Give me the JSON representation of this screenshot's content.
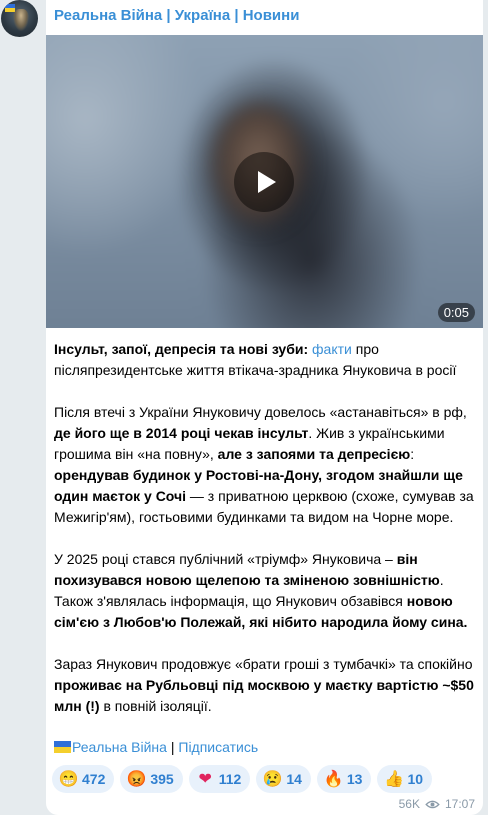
{
  "channel": {
    "name": "Реальна Війна | Україна | Новини"
  },
  "video": {
    "duration": "0:05"
  },
  "post": {
    "p1_b1": "Інсульт, запої, депресія та нові зуби:",
    "p1_link": "факти",
    "p1_t1": " про післяпрезидентське життя втікача-зрадника Януковича в росії",
    "p2_t1": "Після втечі з України Януковичу довелось «астанавіться» в рф, ",
    "p2_b1": "де його ще в 2014 році чекав інсульт",
    "p2_t2": ". Жив з українськими грошима він «на повну», ",
    "p2_b2": "але з запоями та депресією",
    "p2_t3": ": ",
    "p2_b3": "орендував будинок у Ростові-на-Дону, згодом знайшли ще один маєток у Сочі",
    "p2_t4": " — з приватною церквою (схоже, сумував за Межигір'ям), гостьовими будинками та видом на Чорне море.",
    "p3_t1": "У 2025 році стався публічний «тріумф» Януковича – ",
    "p3_b1": "він похизувався новою щелепою та зміненою зовнішністю",
    "p3_t2": ". Також з'являлась інформація, що Янукович обзавівся ",
    "p3_b2": "новою сім'єю з Любов'ю Полежай, які нібито народила йому сина.",
    "p4_t1": "Зараз Янукович продовжує «брати гроші з тумбачкі» та спокійно ",
    "p4_b1": "проживає на Рубльовці під москвою у маєтку вартістю ~$50 млн (!)",
    "p4_t2": " в повній ізоляції."
  },
  "footer": {
    "channel_link": "Реальна Війна",
    "separator": " | ",
    "subscribe_link": "Підписатись"
  },
  "reactions": [
    {
      "emoji": "😁",
      "icon": "grin-emoji-icon",
      "count": "472"
    },
    {
      "emoji": "😡",
      "icon": "angry-emoji-icon",
      "count": "395"
    },
    {
      "emoji": "❤",
      "icon": "heart-emoji-icon",
      "count": "112"
    },
    {
      "emoji": "😢",
      "icon": "cry-emoji-icon",
      "count": "14"
    },
    {
      "emoji": "🔥",
      "icon": "fire-emoji-icon",
      "count": "13"
    },
    {
      "emoji": "👍",
      "icon": "thumbs-up-emoji-icon",
      "count": "10"
    }
  ],
  "meta": {
    "views": "56K",
    "time": "17:07"
  },
  "colors": {
    "link": "#3a8fd6",
    "background": "#e6ebee",
    "reaction_bg": "#e8f1fb"
  }
}
